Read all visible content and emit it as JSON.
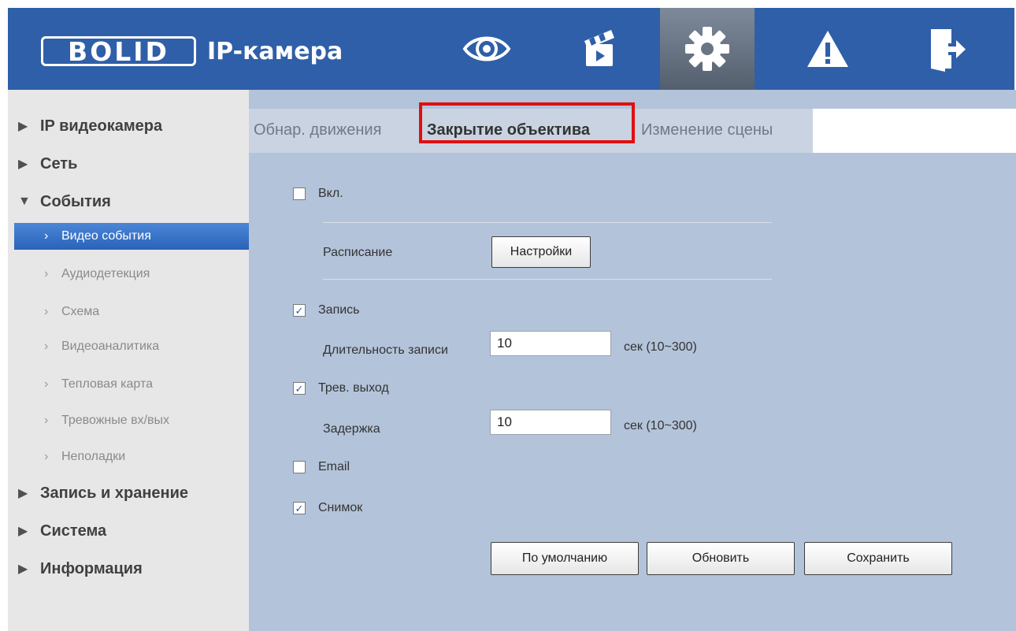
{
  "header": {
    "logo_mark": "BOLID",
    "product": "IP-камера",
    "nav": [
      {
        "name": "live",
        "icon": "eye-icon"
      },
      {
        "name": "playback",
        "icon": "clapperboard-icon"
      },
      {
        "name": "settings",
        "icon": "gear-icon",
        "active": true
      },
      {
        "name": "alarm",
        "icon": "warning-icon"
      },
      {
        "name": "logout",
        "icon": "exit-door-icon"
      }
    ],
    "colors": {
      "bar": "#2f5fa8",
      "active": "#6a7584"
    }
  },
  "sidebar": {
    "sections": [
      {
        "label": "IP видеокамера",
        "arrow": "▶"
      },
      {
        "label": "Сеть",
        "arrow": "▶"
      },
      {
        "label": "События",
        "arrow": "▼"
      },
      {
        "label": "Запись и хранение",
        "arrow": "▶"
      },
      {
        "label": "Система",
        "arrow": "▶"
      },
      {
        "label": "Информация",
        "arrow": "▶"
      }
    ],
    "events_items": [
      {
        "label": "Видео события",
        "selected": true
      },
      {
        "label": "Аудиодетекция"
      },
      {
        "label": "Схема"
      },
      {
        "label": "Видеоаналитика"
      },
      {
        "label": "Тепловая карта"
      },
      {
        "label": "Тревожные вх/вых"
      },
      {
        "label": "Неполадки"
      }
    ],
    "chevron": "›"
  },
  "tabs": {
    "items": [
      "Обнар. движения",
      "Закрытие объектива",
      "Изменение сцены"
    ],
    "active_index": 1
  },
  "form": {
    "enable": {
      "label": "Вкл.",
      "checked": false
    },
    "schedule": {
      "label": "Расписание",
      "button": "Настройки"
    },
    "record": {
      "label": "Запись",
      "checked": true
    },
    "record_duration": {
      "label": "Длительность записи",
      "value": "10",
      "unit": "сек (10~300)"
    },
    "alarm_out": {
      "label": "Трев. выход",
      "checked": true
    },
    "delay": {
      "label": "Задержка",
      "value": "10",
      "unit": "сек (10~300)"
    },
    "email": {
      "label": "Email",
      "checked": false
    },
    "snapshot": {
      "label": "Снимок",
      "checked": true
    },
    "check_mark": "✓"
  },
  "buttons": {
    "default": "По умолчанию",
    "refresh": "Обновить",
    "save": "Сохранить"
  }
}
